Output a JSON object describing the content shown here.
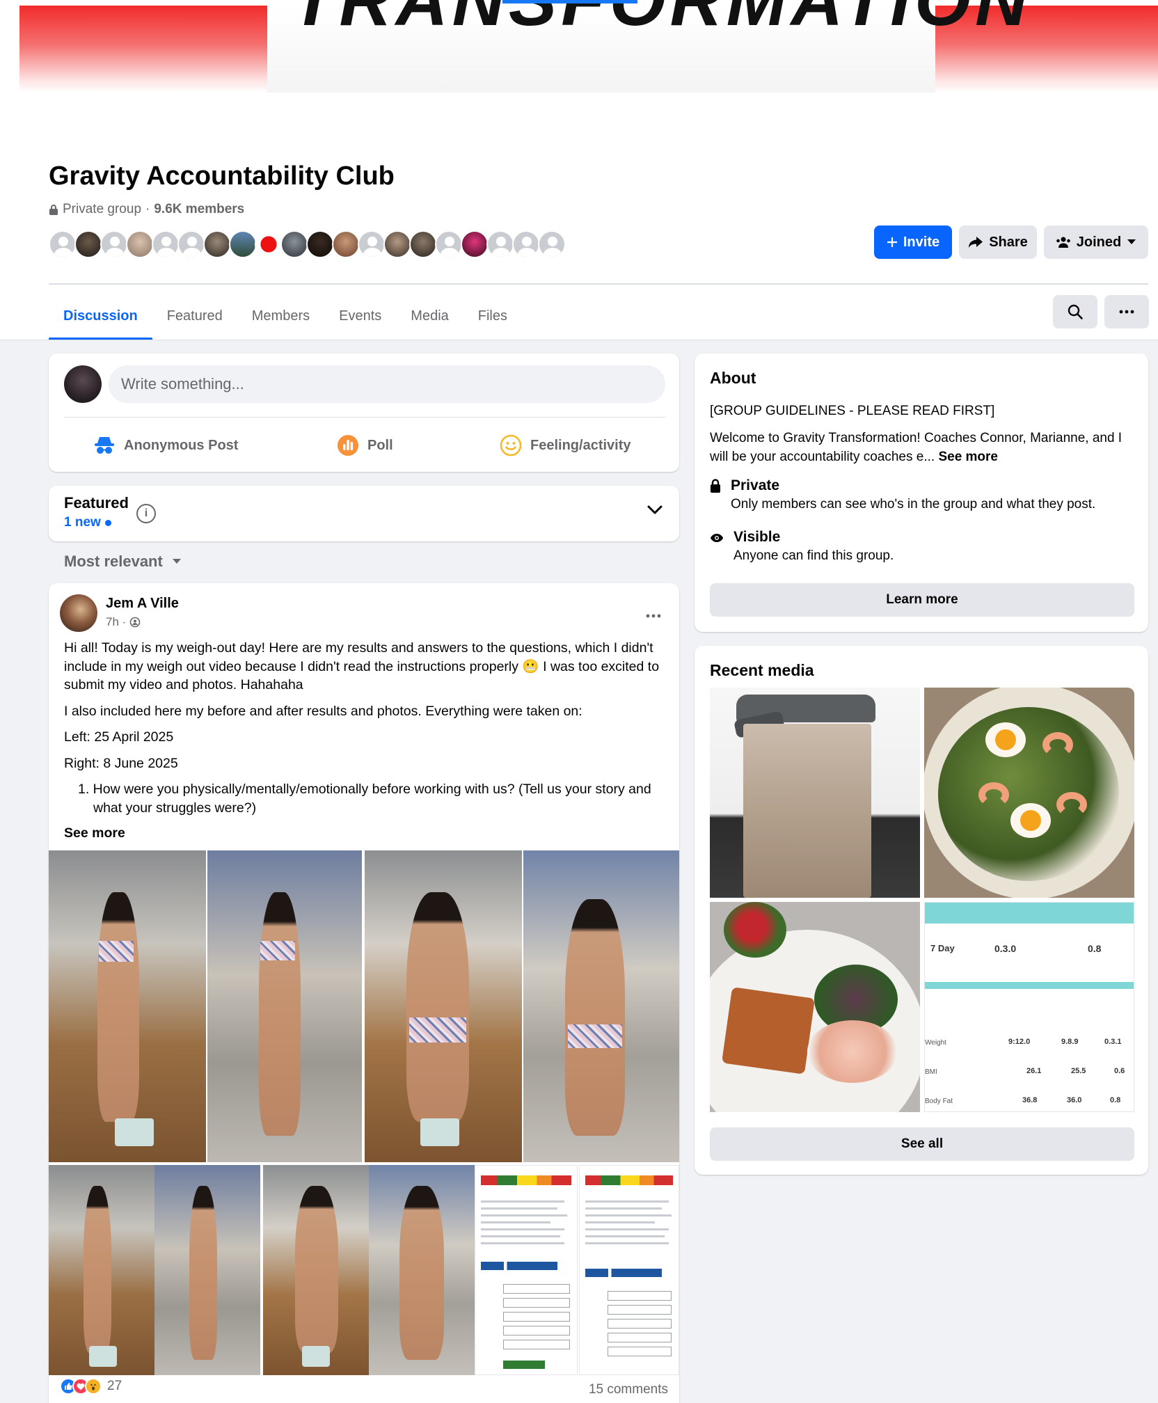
{
  "cover": {
    "title": "TRANSFORMATION"
  },
  "group": {
    "name": "Gravity Accountability Club",
    "privacy": "Private group",
    "separator": "·",
    "members": "9.6K members"
  },
  "actions": {
    "invite": "Invite",
    "share": "Share",
    "joined": "Joined"
  },
  "tabs": [
    "Discussion",
    "Featured",
    "Members",
    "Events",
    "Media",
    "Files"
  ],
  "composer": {
    "placeholder": "Write something...",
    "anonymous": "Anonymous Post",
    "poll": "Poll",
    "feeling": "Feeling/activity"
  },
  "featured": {
    "title": "Featured",
    "new": "1 new",
    "info": "i"
  },
  "sort": {
    "label": "Most relevant"
  },
  "post": {
    "author": "Jem A Ville",
    "time": "7h ·",
    "p1": "Hi all! Today is my weigh-out day! Here are my results and answers to the questions, which I didn't include in my weigh out video because I didn't read the instructions properly 😬 I was too excited to submit my video and photos. Hahahaha",
    "p2": "I also included here my before and after results and photos. Everything were taken on:",
    "p3": "Left: 25 April 2025",
    "p4": "Right: 8 June 2025",
    "p5": "1. How were you physically/mentally/emotionally before working with us? (Tell us your story and what your struggles were?)",
    "see_more": "See more",
    "reaction_count": "27",
    "comments": "15 comments"
  },
  "about": {
    "title": "About",
    "guideline": "[GROUP GUIDELINES - PLEASE READ FIRST]",
    "welcome": "Welcome to Gravity Transformation! Coaches Connor, Marianne, and I will be your accountability coaches e...",
    "see_more": "See more",
    "private_title": "Private",
    "private_desc": "Only members can see who's in the group and what they post.",
    "visible_title": "Visible",
    "visible_desc": "Anyone can find this group.",
    "learn_more": "Learn more"
  },
  "recent_media": {
    "title": "Recent media",
    "see_all": "See all",
    "stats": {
      "days": "7 Day",
      "weight_change": "0.3.0",
      "fat_change": "0.8",
      "row_weight": "Weight",
      "row_bmi": "BMI",
      "row_bodyfat": "Body Fat",
      "w1": "9:12.0",
      "w2": "9.8.9",
      "w3": "0.3.1",
      "b1": "26.1",
      "b2": "25.5",
      "b3": "0.6",
      "f1": "36.8",
      "f2": "36.0",
      "f3": "0.8"
    }
  },
  "colors": {
    "primary": "#0866ff",
    "bg": "#f0f2f5",
    "secondary_text": "#65676b"
  }
}
